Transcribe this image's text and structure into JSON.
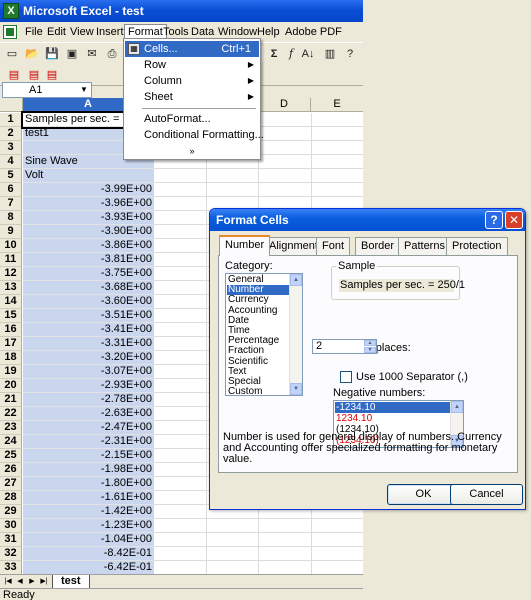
{
  "excel": {
    "title": "Microsoft Excel - test",
    "menu": [
      "File",
      "Edit",
      "View",
      "Insert",
      "Format",
      "Tools",
      "Data",
      "Window",
      "Help",
      "Adobe PDF"
    ],
    "name_box": "A1",
    "columns": [
      "A",
      "D",
      "E"
    ],
    "rows": [
      {
        "n": "1",
        "v": "Samples per sec. = 250/1",
        "num": false
      },
      {
        "n": "2",
        "v": "test1",
        "num": false
      },
      {
        "n": "3",
        "v": "",
        "num": false
      },
      {
        "n": "4",
        "v": "Sine Wave",
        "num": false
      },
      {
        "n": "5",
        "v": "Volt",
        "num": false
      },
      {
        "n": "6",
        "v": "-3.99E+00",
        "num": true
      },
      {
        "n": "7",
        "v": "-3.96E+00",
        "num": true
      },
      {
        "n": "8",
        "v": "-3.93E+00",
        "num": true
      },
      {
        "n": "9",
        "v": "-3.90E+00",
        "num": true
      },
      {
        "n": "10",
        "v": "-3.86E+00",
        "num": true
      },
      {
        "n": "11",
        "v": "-3.81E+00",
        "num": true
      },
      {
        "n": "12",
        "v": "-3.75E+00",
        "num": true
      },
      {
        "n": "13",
        "v": "-3.68E+00",
        "num": true
      },
      {
        "n": "14",
        "v": "-3.60E+00",
        "num": true
      },
      {
        "n": "15",
        "v": "-3.51E+00",
        "num": true
      },
      {
        "n": "16",
        "v": "-3.41E+00",
        "num": true
      },
      {
        "n": "17",
        "v": "-3.31E+00",
        "num": true
      },
      {
        "n": "18",
        "v": "-3.20E+00",
        "num": true
      },
      {
        "n": "19",
        "v": "-3.07E+00",
        "num": true
      },
      {
        "n": "20",
        "v": "-2.93E+00",
        "num": true
      },
      {
        "n": "21",
        "v": "-2.78E+00",
        "num": true
      },
      {
        "n": "22",
        "v": "-2.63E+00",
        "num": true
      },
      {
        "n": "23",
        "v": "-2.47E+00",
        "num": true
      },
      {
        "n": "24",
        "v": "-2.31E+00",
        "num": true
      },
      {
        "n": "25",
        "v": "-2.15E+00",
        "num": true
      },
      {
        "n": "26",
        "v": "-1.98E+00",
        "num": true
      },
      {
        "n": "27",
        "v": "-1.80E+00",
        "num": true
      },
      {
        "n": "28",
        "v": "-1.61E+00",
        "num": true
      },
      {
        "n": "29",
        "v": "-1.42E+00",
        "num": true
      },
      {
        "n": "30",
        "v": "-1.23E+00",
        "num": true
      },
      {
        "n": "31",
        "v": "-1.04E+00",
        "num": true
      },
      {
        "n": "32",
        "v": "-8.42E-01",
        "num": true
      },
      {
        "n": "33",
        "v": "-6.42E-01",
        "num": true
      }
    ],
    "sheet_tab": "test",
    "status": "Ready"
  },
  "format_menu": {
    "items": [
      {
        "label": "Cells...",
        "shortcut": "Ctrl+1",
        "submenu": false,
        "highlighted": true,
        "icon": "format-cells-icon"
      },
      {
        "label": "Row",
        "shortcut": "",
        "submenu": true,
        "highlighted": false
      },
      {
        "label": "Column",
        "shortcut": "",
        "submenu": true,
        "highlighted": false
      },
      {
        "label": "Sheet",
        "shortcut": "",
        "submenu": true,
        "highlighted": false
      },
      {
        "label": "AutoFormat...",
        "shortcut": "",
        "submenu": false,
        "highlighted": false
      },
      {
        "label": "Conditional Formatting...",
        "shortcut": "",
        "submenu": false,
        "highlighted": false
      }
    ],
    "expand_glyph": "»"
  },
  "dialog": {
    "title": "Format Cells",
    "help_glyph": "?",
    "close_glyph": "✕",
    "tabs": [
      "Number",
      "Alignment",
      "Font",
      "Border",
      "Patterns",
      "Protection"
    ],
    "category_label": "Category:",
    "categories": [
      "General",
      "Number",
      "Currency",
      "Accounting",
      "Date",
      "Time",
      "Percentage",
      "Fraction",
      "Scientific",
      "Text",
      "Special",
      "Custom"
    ],
    "sample_label": "Sample",
    "sample_value": "Samples per sec. = 250/1",
    "decimal_label": "Decimal places:",
    "decimal_value": "2",
    "separator_label": "Use 1000 Separator (,)",
    "negative_label": "Negative numbers:",
    "negative_options": [
      {
        "text": "-1234.10",
        "red": false,
        "selected": true
      },
      {
        "text": "1234.10",
        "red": true,
        "selected": false
      },
      {
        "text": "(1234.10)",
        "red": false,
        "selected": false
      },
      {
        "text": "(1234.10)",
        "red": true,
        "selected": false
      }
    ],
    "description": "Number is used for general display of numbers.  Currency and Accounting offer specialized formatting for monetary value.",
    "ok_label": "OK",
    "cancel_label": "Cancel"
  },
  "colors": {
    "selection": "#316ac5",
    "column_a_fill": "#c9d6ee",
    "negative_red": "#e00000",
    "title_blue": "#0a5fe0"
  }
}
